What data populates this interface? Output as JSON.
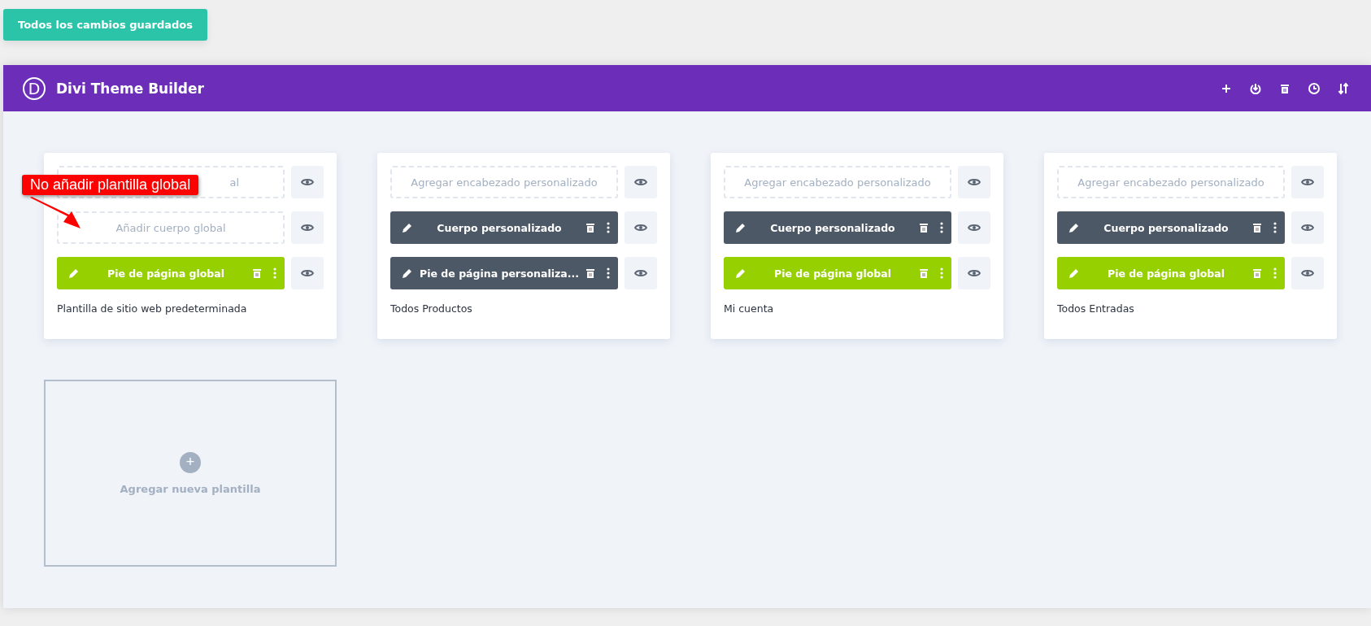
{
  "save_button": "Todos los cambios guardados",
  "window": {
    "title": "Divi Theme Builder",
    "logo": "D"
  },
  "toolbar": [
    {
      "kind": "add"
    },
    {
      "kind": "portability"
    },
    {
      "kind": "delete"
    },
    {
      "kind": "history"
    },
    {
      "kind": "sort"
    }
  ],
  "templates": [
    {
      "title": "Plantilla de sitio web predeterminada",
      "slots": [
        {
          "kind": "placeholder",
          "label": "al"
        },
        {
          "kind": "placeholder",
          "label": "Añadir cuerpo global"
        },
        {
          "kind": "layout",
          "label": "Pie de página global",
          "color": "#97d000"
        }
      ]
    },
    {
      "title": "Todos Productos",
      "slots": [
        {
          "kind": "placeholder",
          "label": "Agregar encabezado personalizado"
        },
        {
          "kind": "layout",
          "label": "Cuerpo personalizado",
          "color": "#4c5866"
        },
        {
          "kind": "layout",
          "label": "Pie de página personaliza...",
          "color": "#4c5866"
        }
      ]
    },
    {
      "title": "Mi cuenta",
      "slots": [
        {
          "kind": "placeholder",
          "label": "Agregar encabezado personalizado"
        },
        {
          "kind": "layout",
          "label": "Cuerpo personalizado",
          "color": "#4c5866"
        },
        {
          "kind": "layout",
          "label": "Pie de página global",
          "color": "#97d000"
        }
      ]
    },
    {
      "title": "Todos Entradas",
      "slots": [
        {
          "kind": "placeholder",
          "label": "Agregar encabezado personalizado"
        },
        {
          "kind": "layout",
          "label": "Cuerpo personalizado",
          "color": "#4c5866"
        },
        {
          "kind": "layout",
          "label": "Pie de página global",
          "color": "#97d000"
        }
      ]
    }
  ],
  "add_template": {
    "label": "Agregar nueva plantilla",
    "icon": "+"
  },
  "callout": "No añadir plantilla global"
}
